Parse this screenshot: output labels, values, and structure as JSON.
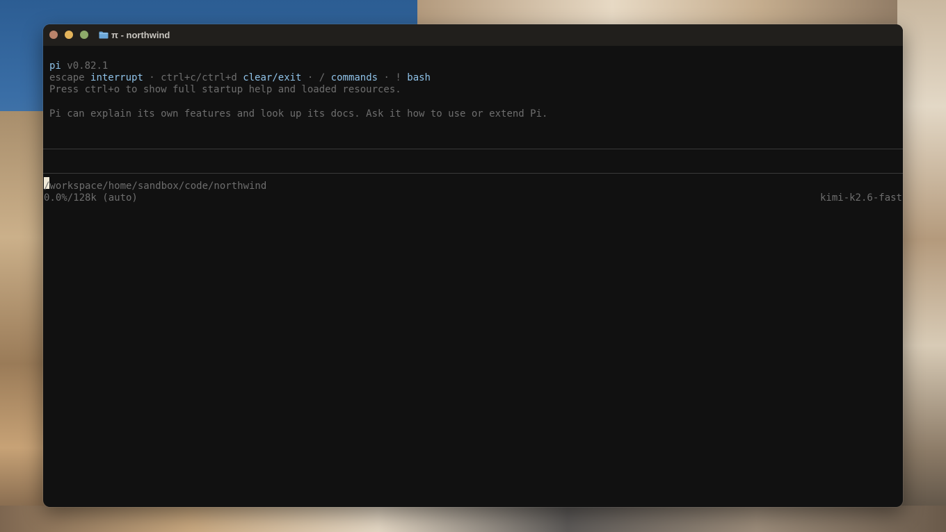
{
  "window": {
    "title": "π - northwind",
    "title_icon": "folder-icon"
  },
  "banner": {
    "app_name": "pi",
    "version": "v0.82.1",
    "shortcuts": [
      {
        "key": "escape",
        "label": "interrupt"
      },
      {
        "key": "ctrl+c/ctrl+d",
        "label": "clear/exit"
      },
      {
        "key": "/",
        "label": "commands"
      },
      {
        "key": "!",
        "label": "bash"
      }
    ],
    "separator": " · ",
    "help_hint": "Press ctrl+o to show full startup help and loaded resources.",
    "tip": "Pi can explain its own features and look up its docs. Ask it how to use or extend Pi."
  },
  "status": {
    "cwd": "/workspace/home/sandbox/code/northwind",
    "context_usage": "0.0%/128k (auto)",
    "model": "kimi-k2.6-fast"
  },
  "colors": {
    "accent": "#8fc2e8",
    "dim_text": "#6e6e6e",
    "background": "#111111",
    "cursor": "#f1ead8"
  }
}
